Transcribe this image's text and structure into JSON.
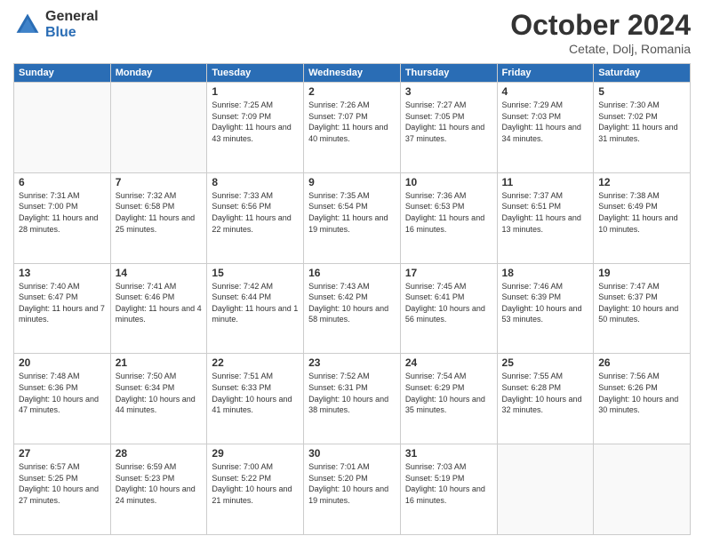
{
  "header": {
    "logo_general": "General",
    "logo_blue": "Blue",
    "month_title": "October 2024",
    "location": "Cetate, Dolj, Romania"
  },
  "weekdays": [
    "Sunday",
    "Monday",
    "Tuesday",
    "Wednesday",
    "Thursday",
    "Friday",
    "Saturday"
  ],
  "weeks": [
    [
      {
        "day": "",
        "info": ""
      },
      {
        "day": "",
        "info": ""
      },
      {
        "day": "1",
        "info": "Sunrise: 7:25 AM\nSunset: 7:09 PM\nDaylight: 11 hours and 43 minutes."
      },
      {
        "day": "2",
        "info": "Sunrise: 7:26 AM\nSunset: 7:07 PM\nDaylight: 11 hours and 40 minutes."
      },
      {
        "day": "3",
        "info": "Sunrise: 7:27 AM\nSunset: 7:05 PM\nDaylight: 11 hours and 37 minutes."
      },
      {
        "day": "4",
        "info": "Sunrise: 7:29 AM\nSunset: 7:03 PM\nDaylight: 11 hours and 34 minutes."
      },
      {
        "day": "5",
        "info": "Sunrise: 7:30 AM\nSunset: 7:02 PM\nDaylight: 11 hours and 31 minutes."
      }
    ],
    [
      {
        "day": "6",
        "info": "Sunrise: 7:31 AM\nSunset: 7:00 PM\nDaylight: 11 hours and 28 minutes."
      },
      {
        "day": "7",
        "info": "Sunrise: 7:32 AM\nSunset: 6:58 PM\nDaylight: 11 hours and 25 minutes."
      },
      {
        "day": "8",
        "info": "Sunrise: 7:33 AM\nSunset: 6:56 PM\nDaylight: 11 hours and 22 minutes."
      },
      {
        "day": "9",
        "info": "Sunrise: 7:35 AM\nSunset: 6:54 PM\nDaylight: 11 hours and 19 minutes."
      },
      {
        "day": "10",
        "info": "Sunrise: 7:36 AM\nSunset: 6:53 PM\nDaylight: 11 hours and 16 minutes."
      },
      {
        "day": "11",
        "info": "Sunrise: 7:37 AM\nSunset: 6:51 PM\nDaylight: 11 hours and 13 minutes."
      },
      {
        "day": "12",
        "info": "Sunrise: 7:38 AM\nSunset: 6:49 PM\nDaylight: 11 hours and 10 minutes."
      }
    ],
    [
      {
        "day": "13",
        "info": "Sunrise: 7:40 AM\nSunset: 6:47 PM\nDaylight: 11 hours and 7 minutes."
      },
      {
        "day": "14",
        "info": "Sunrise: 7:41 AM\nSunset: 6:46 PM\nDaylight: 11 hours and 4 minutes."
      },
      {
        "day": "15",
        "info": "Sunrise: 7:42 AM\nSunset: 6:44 PM\nDaylight: 11 hours and 1 minute."
      },
      {
        "day": "16",
        "info": "Sunrise: 7:43 AM\nSunset: 6:42 PM\nDaylight: 10 hours and 58 minutes."
      },
      {
        "day": "17",
        "info": "Sunrise: 7:45 AM\nSunset: 6:41 PM\nDaylight: 10 hours and 56 minutes."
      },
      {
        "day": "18",
        "info": "Sunrise: 7:46 AM\nSunset: 6:39 PM\nDaylight: 10 hours and 53 minutes."
      },
      {
        "day": "19",
        "info": "Sunrise: 7:47 AM\nSunset: 6:37 PM\nDaylight: 10 hours and 50 minutes."
      }
    ],
    [
      {
        "day": "20",
        "info": "Sunrise: 7:48 AM\nSunset: 6:36 PM\nDaylight: 10 hours and 47 minutes."
      },
      {
        "day": "21",
        "info": "Sunrise: 7:50 AM\nSunset: 6:34 PM\nDaylight: 10 hours and 44 minutes."
      },
      {
        "day": "22",
        "info": "Sunrise: 7:51 AM\nSunset: 6:33 PM\nDaylight: 10 hours and 41 minutes."
      },
      {
        "day": "23",
        "info": "Sunrise: 7:52 AM\nSunset: 6:31 PM\nDaylight: 10 hours and 38 minutes."
      },
      {
        "day": "24",
        "info": "Sunrise: 7:54 AM\nSunset: 6:29 PM\nDaylight: 10 hours and 35 minutes."
      },
      {
        "day": "25",
        "info": "Sunrise: 7:55 AM\nSunset: 6:28 PM\nDaylight: 10 hours and 32 minutes."
      },
      {
        "day": "26",
        "info": "Sunrise: 7:56 AM\nSunset: 6:26 PM\nDaylight: 10 hours and 30 minutes."
      }
    ],
    [
      {
        "day": "27",
        "info": "Sunrise: 6:57 AM\nSunset: 5:25 PM\nDaylight: 10 hours and 27 minutes."
      },
      {
        "day": "28",
        "info": "Sunrise: 6:59 AM\nSunset: 5:23 PM\nDaylight: 10 hours and 24 minutes."
      },
      {
        "day": "29",
        "info": "Sunrise: 7:00 AM\nSunset: 5:22 PM\nDaylight: 10 hours and 21 minutes."
      },
      {
        "day": "30",
        "info": "Sunrise: 7:01 AM\nSunset: 5:20 PM\nDaylight: 10 hours and 19 minutes."
      },
      {
        "day": "31",
        "info": "Sunrise: 7:03 AM\nSunset: 5:19 PM\nDaylight: 10 hours and 16 minutes."
      },
      {
        "day": "",
        "info": ""
      },
      {
        "day": "",
        "info": ""
      }
    ]
  ]
}
